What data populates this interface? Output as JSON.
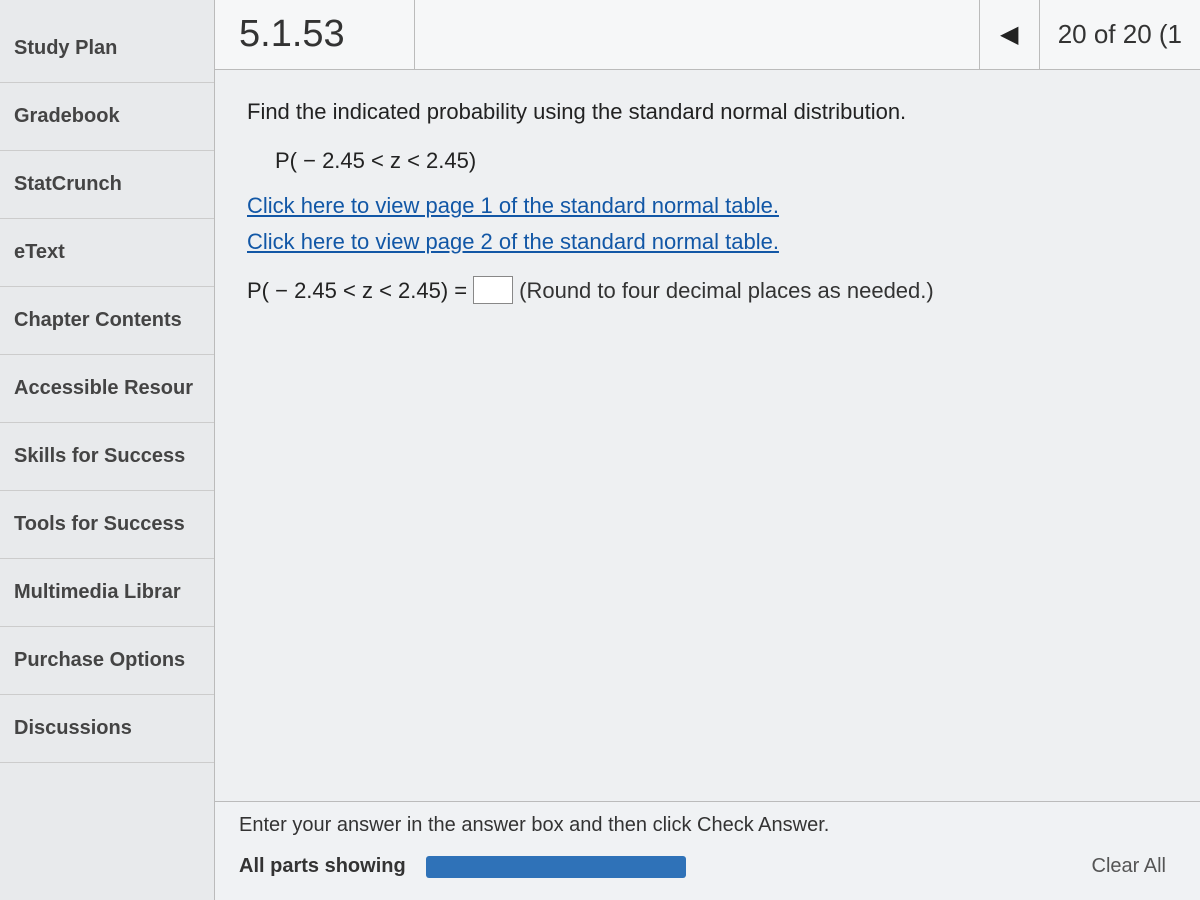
{
  "sidebar": {
    "items": [
      {
        "label": "Study Plan"
      },
      {
        "label": "Gradebook"
      },
      {
        "label": "StatCrunch"
      },
      {
        "label": "eText"
      },
      {
        "label": "Chapter Contents"
      },
      {
        "label": "Accessible Resour"
      },
      {
        "label": "Skills for Success"
      },
      {
        "label": "Tools for Success"
      },
      {
        "label": "Multimedia Librar"
      },
      {
        "label": "Purchase Options"
      },
      {
        "label": "Discussions"
      }
    ]
  },
  "header": {
    "question_number": "5.1.53",
    "counter": "20 of 20 (1"
  },
  "question": {
    "prompt": "Find the indicated probability using the standard normal distribution.",
    "formula_given": "P( − 2.45 < z < 2.45)",
    "link1": "Click here to view page 1 of the standard normal table.",
    "link2": "Click here to view page 2 of the standard normal table.",
    "answer_prefix": "P( − 2.45 < z < 2.45) =",
    "answer_hint": "(Round to four decimal places as needed.)"
  },
  "footer": {
    "instruction": "Enter your answer in the answer box and then click Check Answer.",
    "parts_label": "All parts showing",
    "clear_all": "Clear All"
  }
}
